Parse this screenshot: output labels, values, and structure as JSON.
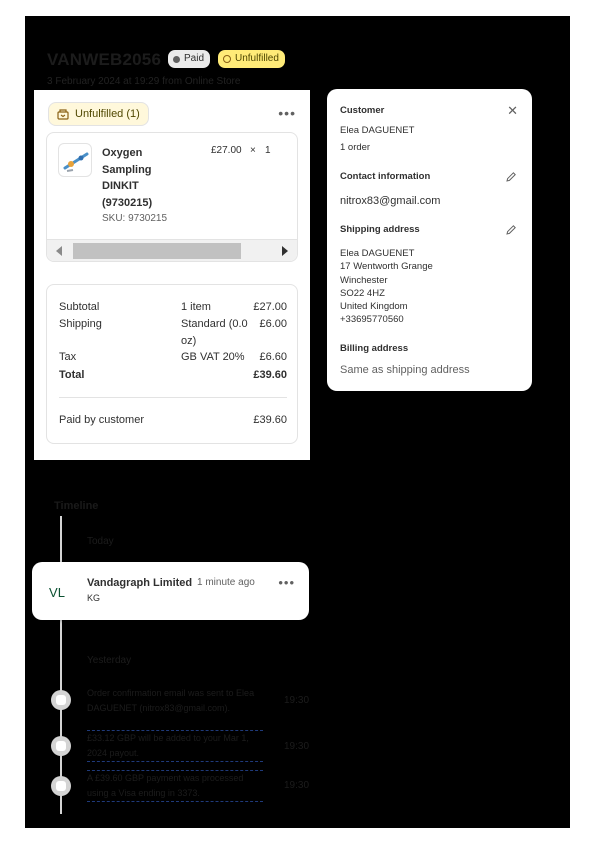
{
  "order": {
    "number": "VANWEB2056",
    "payment_badge": "Paid",
    "fulfillment_badge": "Unfulfilled",
    "date_line": "3 February 2024 at 19:29 from Online Store"
  },
  "fulfillment": {
    "button_label": "Unfulfilled (1)",
    "menu_label": "•••",
    "item": {
      "name": "Oxygen Sampling DINKIT (9730215)",
      "sku": "SKU: 9730215",
      "price": "£27.00",
      "times": "×",
      "quantity": "1"
    }
  },
  "totals": {
    "subtotal": {
      "label": "Subtotal",
      "detail": "1 item",
      "value": "£27.00"
    },
    "shipping": {
      "label": "Shipping",
      "detail": "Standard (0.0 oz)",
      "value": "£6.00"
    },
    "tax": {
      "label": "Tax",
      "detail": "GB VAT 20%",
      "value": "£6.60"
    },
    "total": {
      "label": "Total",
      "value": "£39.60"
    },
    "paid": {
      "label": "Paid by customer",
      "value": "£39.60"
    }
  },
  "customer": {
    "heading": "Customer",
    "close_label": "✕",
    "name": "Elea DAGUENET",
    "orders": "1 order",
    "contact_heading": "Contact information",
    "email": "nitrox83@gmail.com",
    "shipping_heading": "Shipping address",
    "address_lines": [
      "Elea DAGUENET",
      "17 Wentworth Grange",
      "Winchester",
      "SO22 4HZ",
      "United Kingdom",
      "+33695770560"
    ],
    "billing_heading": "Billing address",
    "billing_value": "Same as shipping address"
  },
  "timeline": {
    "title": "Timeline",
    "today_label": "Today",
    "yesterday_label": "Yesterday",
    "comment": {
      "avatar": "VL",
      "author": "Vandagraph Limited",
      "time": "1 minute ago",
      "body": "KG",
      "menu_label": "•••"
    },
    "events": [
      {
        "text": "Order confirmation email was sent to Elea DAGUENET (nitrox83@gmail.com).",
        "time": "19:30"
      },
      {
        "text": "£33.12 GBP will be added to your Mar 1, 2024 payout.",
        "time": "19:30"
      },
      {
        "text": "A £39.60 GBP payment was processed using a Visa ending in 3373.",
        "time": "19:30"
      }
    ]
  },
  "colors": {
    "backdrop": "#000000",
    "unfulfilled_badge": "#ffeb78",
    "paid_badge": "#ebebeb",
    "avatar_text": "#0c5132"
  },
  "icons": [
    "fulfillment-box-icon",
    "close-icon",
    "pencil-icon",
    "chevron-left-icon",
    "chevron-right-icon",
    "ellipsis-icon",
    "timeline-event-icon"
  ]
}
